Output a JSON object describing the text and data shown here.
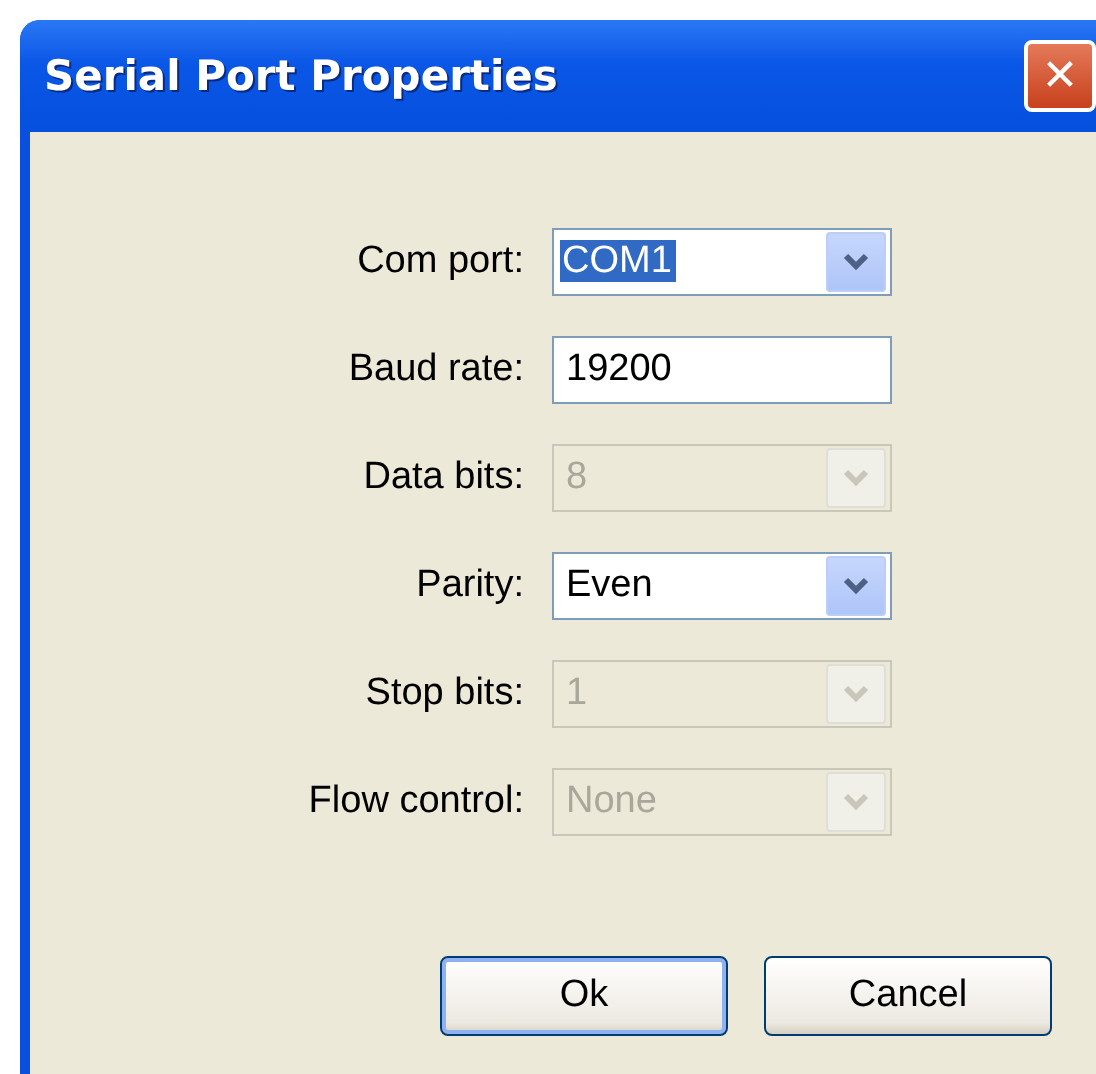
{
  "window": {
    "title": "Serial Port Properties",
    "close": "✕"
  },
  "fields": [
    {
      "label": "Com port:",
      "kind": "combo",
      "value": "COM1",
      "disabled": false,
      "highlighted": true
    },
    {
      "label": "Baud rate:",
      "kind": "text",
      "value": "19200",
      "disabled": false,
      "highlighted": false
    },
    {
      "label": "Data bits:",
      "kind": "combo",
      "value": "8",
      "disabled": true,
      "highlighted": false
    },
    {
      "label": "Parity:",
      "kind": "combo",
      "value": "Even",
      "disabled": false,
      "highlighted": false
    },
    {
      "label": "Stop bits:",
      "kind": "combo",
      "value": "1",
      "disabled": true,
      "highlighted": false
    },
    {
      "label": "Flow control:",
      "kind": "combo",
      "value": "None",
      "disabled": true,
      "highlighted": false
    }
  ],
  "buttons": [
    {
      "label": "Ok",
      "default": true
    },
    {
      "label": "Cancel",
      "default": false
    }
  ]
}
